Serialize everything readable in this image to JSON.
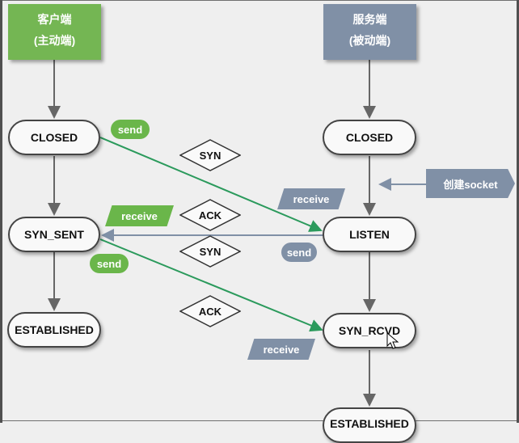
{
  "client_header": {
    "line1": "客户端",
    "line2": "(主动端)"
  },
  "server_header": {
    "line1": "服务端",
    "line2": "(被动端)"
  },
  "client_states": [
    "CLOSED",
    "SYN_SENT",
    "ESTABLISHED"
  ],
  "server_states": [
    "CLOSED",
    "LISTEN",
    "SYN_RCVD",
    "ESTABLISHED"
  ],
  "segments": [
    "SYN",
    "ACK",
    "SYN",
    "ACK"
  ],
  "actions": {
    "send_1": "send",
    "receive_1": "receive",
    "receive_2": "receive",
    "send_2": "send",
    "send_3": "send",
    "receive_3": "receive"
  },
  "callout": "创建socket",
  "colors": {
    "client": "#74b653",
    "server": "#8090a6",
    "arrow_green": "#2b9a5c",
    "arrow_gray": "#8090a6",
    "flow": "#666666"
  }
}
